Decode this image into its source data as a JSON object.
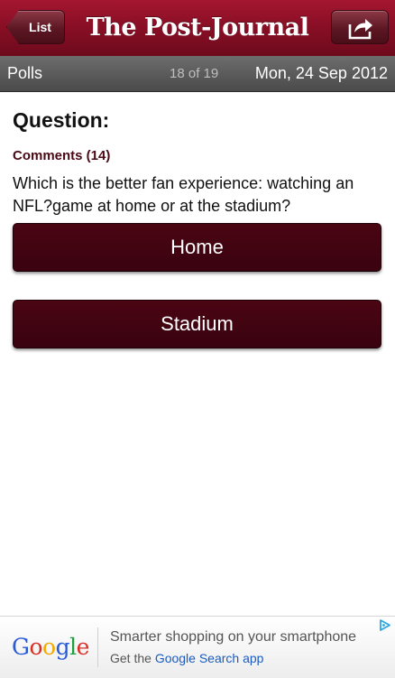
{
  "header": {
    "back_label": "List",
    "title": "The Post-Journal",
    "share_icon": "share-icon"
  },
  "subbar": {
    "section": "Polls",
    "counter": "18 of 19",
    "date": "Mon, 24 Sep 2012"
  },
  "poll": {
    "heading": "Question:",
    "comments_label": "Comments (14)",
    "question": "Which is the better fan experience: watching an NFL?game at home or at the stadium?",
    "options": [
      "Home",
      "Stadium"
    ]
  },
  "ad": {
    "logo_letters": [
      "G",
      "o",
      "o",
      "g",
      "l",
      "e"
    ],
    "logo_colors": [
      "#2a5bd7",
      "#d93025",
      "#f2a900",
      "#2a5bd7",
      "#1e9e3e",
      "#d93025"
    ],
    "headline": "Smarter shopping on your smartphone",
    "subline_prefix": "Get the ",
    "subline_link": "Google Search app",
    "choices_icon": "ad-choices-icon"
  },
  "colors": {
    "header": "#8a0f26",
    "button": "#3f0311",
    "comments": "#4b0815",
    "link": "#1a5bbf"
  }
}
